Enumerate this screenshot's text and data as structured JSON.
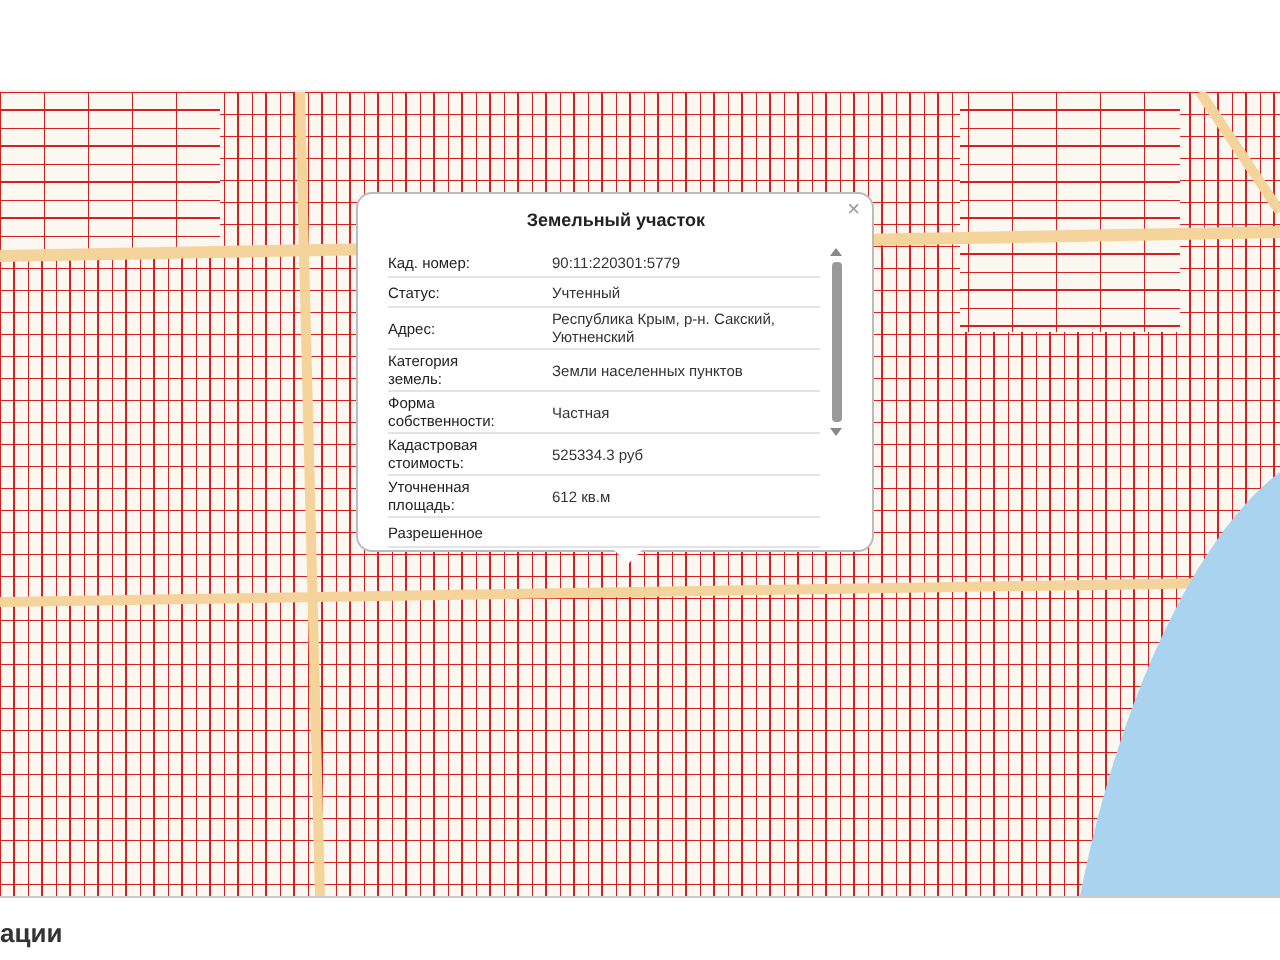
{
  "popup": {
    "title": "Земельный участок",
    "close": "×",
    "rows": [
      {
        "label": "Кад. номер:",
        "value": "90:11:220301:5779"
      },
      {
        "label": "Статус:",
        "value": "Учтенный"
      },
      {
        "label": "Адрес:",
        "value": "Республика Крым, р-н. Сакский, Уютненский"
      },
      {
        "label": "Категория земель:",
        "value": "Земли населенных пунктов"
      },
      {
        "label": "Форма собственности:",
        "value": "Частная"
      },
      {
        "label": "Кадастровая стоимость:",
        "value": "525334.3 руб"
      },
      {
        "label": "Уточненная площадь:",
        "value": "612 кв.м"
      },
      {
        "label": "Разрешенное"
      }
    ]
  },
  "section_heading": "ации"
}
